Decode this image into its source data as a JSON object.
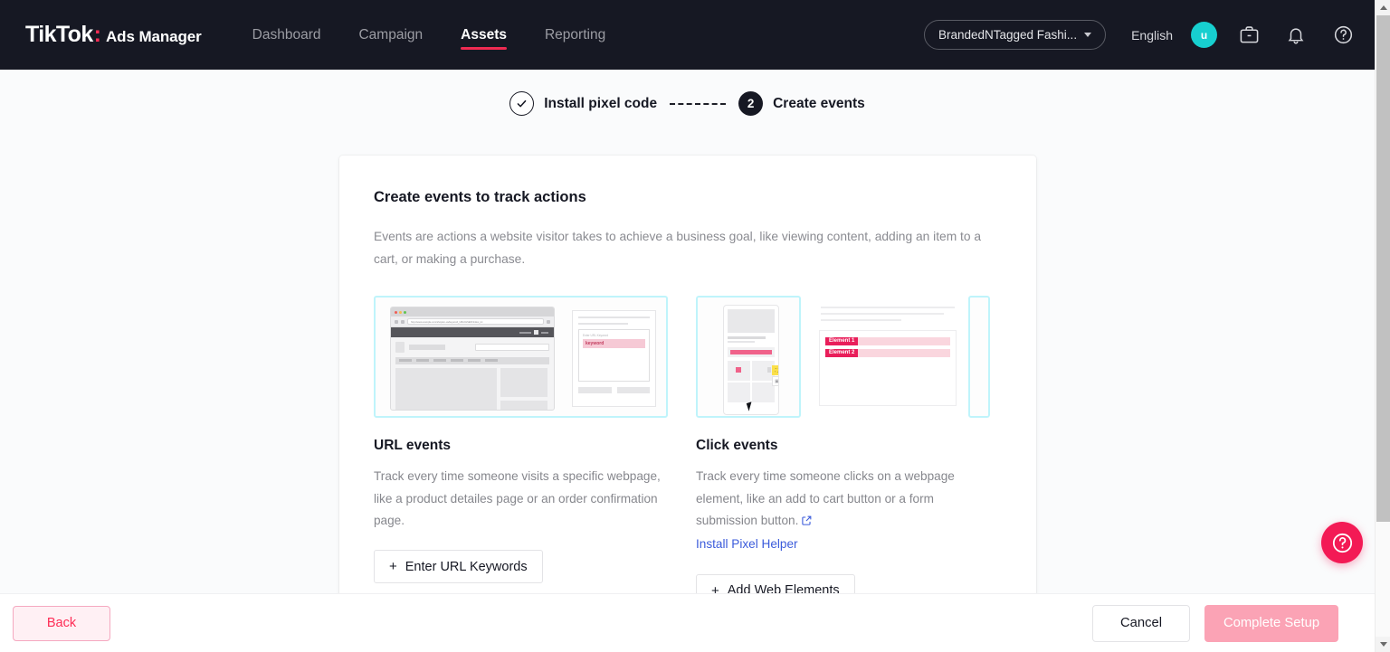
{
  "header": {
    "brand_primary": "TikTok",
    "brand_colon": ":",
    "brand_secondary": "Ads Manager",
    "nav": [
      {
        "label": "Dashboard",
        "active": false
      },
      {
        "label": "Campaign",
        "active": false
      },
      {
        "label": "Assets",
        "active": true
      },
      {
        "label": "Reporting",
        "active": false
      }
    ],
    "account_selector": "BrandedNTagged Fashi...",
    "language": "English",
    "avatar_initial": "u",
    "icons": [
      "briefcase-icon",
      "bell-icon",
      "help-circle-icon"
    ],
    "accent_color": "#ef2b52",
    "background_color": "#161823",
    "avatar_color": "#17cfcf"
  },
  "stepper": {
    "step1_label": "Install pixel code",
    "step1_state": "completed",
    "step1_glyph": "✓",
    "step2_number": "2",
    "step2_label": "Create events",
    "step2_state": "active"
  },
  "card": {
    "title": "Create events to track actions",
    "description": "Events are actions a website visitor takes to achieve a business goal, like viewing content, adding an item to a cart, or making a purchase."
  },
  "options": [
    {
      "id": "url-events",
      "title": "URL events",
      "description": "Track every time someone visits a specific webpage, like a product detailes page or an order confirmation page.",
      "button_label": "Enter URL Keywords",
      "button_plus": "+",
      "illustration": {
        "type": "browser-url-keyword",
        "url_text": "http://www.example.com/shop/en-us/keyword_URLFHSEFFIndex_txt",
        "panel_label": "Enter URL Keyword",
        "keyword_chip": "keyword",
        "border_color": "#bff4fb",
        "chip_bg": "#f6c9d5",
        "chip_text_color": "#c23b5d"
      }
    },
    {
      "id": "click-events",
      "title": "Click events",
      "description": "Track every time someone clicks on a webpage element, like an add to cart button or a form submission button.",
      "link_label": "Install Pixel Helper",
      "link_color": "#3b5bdb",
      "external_icon": "external-link-icon",
      "button_label": "Add Web Elements",
      "button_plus": "+",
      "illustration": {
        "type": "phone-element-picker",
        "element_badges": [
          "Element 1",
          "Element 2"
        ],
        "badge_bg": "#e91e5a",
        "badge_row_bg": "#fad6de",
        "border_color": "#bff4fb"
      }
    }
  ],
  "footer": {
    "back_label": "Back",
    "cancel_label": "Cancel",
    "complete_label": "Complete Setup",
    "complete_disabled": true,
    "back_color": "#fe2c55",
    "complete_bg": "#fba3b5"
  },
  "help_fab": {
    "icon": "question-mark-circle-icon",
    "color": "#f31a55"
  },
  "scrollbar": {
    "up_icon": "scroll-up-arrow-icon",
    "down_icon": "scroll-down-arrow-icon"
  }
}
